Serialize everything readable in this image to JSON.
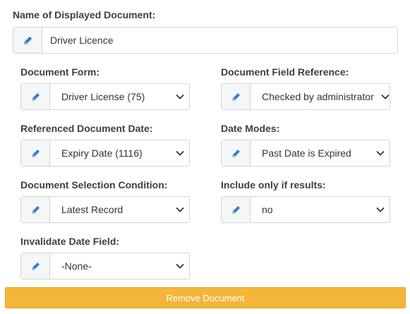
{
  "name_field": {
    "label": "Name of Displayed Document:",
    "value": "Driver Licence",
    "icon": "pencil-icon"
  },
  "document_form": {
    "label": "Document Form:",
    "value": "Driver License (75)"
  },
  "document_field_reference": {
    "label": "Document Field Reference:",
    "value": "Checked by administrator"
  },
  "referenced_document_date": {
    "label": "Referenced Document Date:",
    "value": "Expiry Date (1116)"
  },
  "date_modes": {
    "label": "Date Modes:",
    "value": "Past Date is Expired"
  },
  "document_selection_condition": {
    "label": "Document Selection Condition:",
    "value": "Latest Record"
  },
  "include_only_if_results": {
    "label": "Include only if results:",
    "value": "no"
  },
  "invalidate_date_field": {
    "label": "Invalidate Date Field:",
    "value": "-None-"
  },
  "remove_button": {
    "label": "Remove Document"
  },
  "colors": {
    "icon_blue": "#2a7fd4",
    "button_orange": "#f3b63a",
    "addon_bg": "#f5f6f7",
    "border": "#cfd4da"
  }
}
